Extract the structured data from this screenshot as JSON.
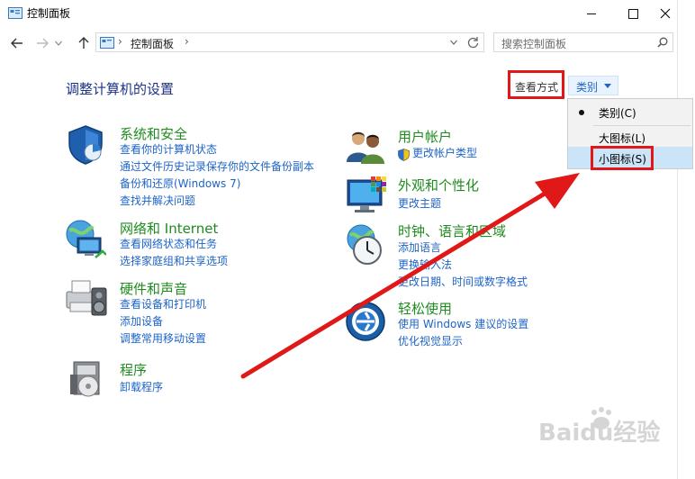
{
  "window": {
    "title": "控制面板",
    "minimize_glyph": "—",
    "maximize_glyph": "☐",
    "close_glyph": "✕"
  },
  "nav": {
    "address_text": "控制面板",
    "search_placeholder": "搜索控制面板"
  },
  "page": {
    "title": "调整计算机的设置",
    "view_by_label": "查看方式",
    "view_mode_value": "类别"
  },
  "view_menu": {
    "items": [
      {
        "label": "类别(C)",
        "selected": true
      },
      {
        "label": "大图标(L)",
        "selected": false
      },
      {
        "label": "小图标(S)",
        "selected": false,
        "hovered": true
      }
    ]
  },
  "categories": [
    {
      "title": "系统和安全",
      "icon": "system-security-icon",
      "links": [
        "查看你的计算机状态",
        "通过文件历史记录保存你的文件备份副本",
        "备份和还原(Windows 7)",
        "查找并解决问题"
      ]
    },
    {
      "title": "网络和 Internet",
      "icon": "network-icon",
      "links": [
        "查看网络状态和任务",
        "选择家庭组和共享选项"
      ]
    },
    {
      "title": "硬件和声音",
      "icon": "hardware-sound-icon",
      "links": [
        "查看设备和打印机",
        "添加设备",
        "调整常用移动设置"
      ]
    },
    {
      "title": "程序",
      "icon": "programs-icon",
      "links": [
        "卸载程序"
      ]
    },
    {
      "title": "用户帐户",
      "icon": "user-accounts-icon",
      "links": [
        "更改帐户类型"
      ]
    },
    {
      "title": "外观和个性化",
      "icon": "appearance-icon",
      "links": [
        "更改主题"
      ]
    },
    {
      "title": "时钟、语言和区域",
      "icon": "clock-region-icon",
      "links": [
        "添加语言",
        "更换输入法",
        "更改日期、时间或数字格式"
      ]
    },
    {
      "title": "轻松使用",
      "icon": "ease-of-access-icon",
      "links": [
        "使用 Windows 建议的设置",
        "优化视觉显示"
      ]
    }
  ],
  "watermark": "Baidu经验",
  "colors": {
    "category_title": "#1e8c1e",
    "link": "#1e64c8",
    "page_title": "#1e3287",
    "annotation_red": "#e01818"
  }
}
